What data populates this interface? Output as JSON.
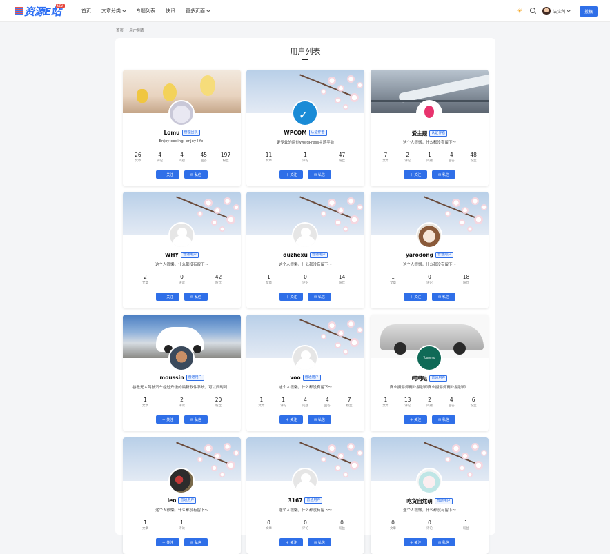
{
  "header": {
    "logo_text": "资源E站",
    "logo_badge": "NEW",
    "nav": [
      "首页",
      "文章分类",
      "专题列表",
      "快讯",
      "更多页面"
    ],
    "nav_dropdown": [
      false,
      true,
      false,
      false,
      true
    ],
    "user_name": "法拉利",
    "post_button": "投稿"
  },
  "breadcrumb": {
    "home": "首页",
    "current": "用户列表"
  },
  "page": {
    "title": "用户列表"
  },
  "actions": {
    "follow": "＋ 关注",
    "message": "✉ 私信"
  },
  "users": [
    {
      "name": "Lomu",
      "badge": "管理团队",
      "bio": "Enjoy coding, enjoy life!",
      "cover": "chicks",
      "avatar": "cat",
      "stats": [
        {
          "v": "26",
          "l": "文章"
        },
        {
          "v": "4",
          "l": "评论"
        },
        {
          "v": "4",
          "l": "问题"
        },
        {
          "v": "45",
          "l": "回答"
        },
        {
          "v": "197",
          "l": "粉丝"
        }
      ]
    },
    {
      "name": "WPCOM",
      "badge": "认证作者",
      "bio": "更专业的原创WordPress主题平台",
      "cover": "blossom",
      "avatar": "wpcom",
      "stats": [
        {
          "v": "11",
          "l": "文章"
        },
        {
          "v": "1",
          "l": "评论"
        },
        {
          "v": "47",
          "l": "粉丝"
        }
      ]
    },
    {
      "name": "爱主题",
      "badge": "认证作者",
      "bio": "这个人很懒，什么都没有留下～",
      "cover": "train",
      "avatar": "heart",
      "stats": [
        {
          "v": "7",
          "l": "文章"
        },
        {
          "v": "2",
          "l": "评论"
        },
        {
          "v": "1",
          "l": "问题"
        },
        {
          "v": "4",
          "l": "回答"
        },
        {
          "v": "48",
          "l": "粉丝"
        }
      ]
    },
    {
      "name": "WHY",
      "badge": "普通用户",
      "bio": "这个人很懒，什么都没有留下～",
      "cover": "blossom",
      "avatar": "default",
      "stats": [
        {
          "v": "2",
          "l": "文章"
        },
        {
          "v": "0",
          "l": "评论"
        },
        {
          "v": "42",
          "l": "粉丝"
        }
      ]
    },
    {
      "name": "duzhexu",
      "badge": "普通用户",
      "bio": "这个人很懒，什么都没有留下～",
      "cover": "blossom",
      "avatar": "default",
      "stats": [
        {
          "v": "1",
          "l": "文章"
        },
        {
          "v": "0",
          "l": "评论"
        },
        {
          "v": "14",
          "l": "粉丝"
        }
      ]
    },
    {
      "name": "yarodong",
      "badge": "普通用户",
      "bio": "这个人很懒，什么都没有留下～",
      "cover": "blossom",
      "avatar": "anime",
      "stats": [
        {
          "v": "1",
          "l": "文章"
        },
        {
          "v": "0",
          "l": "评论"
        },
        {
          "v": "18",
          "l": "粉丝"
        }
      ]
    },
    {
      "name": "moussin",
      "badge": "普通用户",
      "bio": "谷歌无人驾驶汽车经过升级的最新软件系统，可以同时对...",
      "cover": "car1",
      "avatar": "man",
      "stats": [
        {
          "v": "1",
          "l": "文章"
        },
        {
          "v": "2",
          "l": "评论"
        },
        {
          "v": "20",
          "l": "粉丝"
        }
      ]
    },
    {
      "name": "voo",
      "badge": "普通用户",
      "bio": "这个人很懒，什么都没有留下～",
      "cover": "blossom",
      "avatar": "default",
      "stats": [
        {
          "v": "1",
          "l": "文章"
        },
        {
          "v": "1",
          "l": "评论"
        },
        {
          "v": "4",
          "l": "问题"
        },
        {
          "v": "4",
          "l": "回答"
        },
        {
          "v": "7",
          "l": "粉丝"
        }
      ]
    },
    {
      "name": "呵呵哒",
      "badge": "普通用户",
      "bio": "商业摄影师商业摄影师商业摄影师商业摄影师...",
      "cover": "car2",
      "avatar": "toommo",
      "stats": [
        {
          "v": "1",
          "l": "文章"
        },
        {
          "v": "13",
          "l": "评论"
        },
        {
          "v": "2",
          "l": "问题"
        },
        {
          "v": "4",
          "l": "回答"
        },
        {
          "v": "6",
          "l": "粉丝"
        }
      ]
    },
    {
      "name": "leo",
      "badge": "普通用户",
      "bio": "这个人很懒，什么都没有留下～",
      "cover": "blossom",
      "avatar": "photo",
      "stats": [
        {
          "v": "1",
          "l": "文章"
        },
        {
          "v": "1",
          "l": "评论"
        },
        {
          "v": "",
          "l": ""
        }
      ]
    },
    {
      "name": "3167",
      "badge": "普通用户",
      "bio": "这个人很懒，什么都没有留下～",
      "cover": "blossom",
      "avatar": "default",
      "stats": [
        {
          "v": "0",
          "l": "文章"
        },
        {
          "v": "0",
          "l": "评论"
        },
        {
          "v": "0",
          "l": "粉丝"
        }
      ]
    },
    {
      "name": "吃货自然萌",
      "badge": "普通用户",
      "bio": "这个人很懒，什么都没有留下～",
      "cover": "blossom",
      "avatar": "anime2",
      "stats": [
        {
          "v": "0",
          "l": "文章"
        },
        {
          "v": "0",
          "l": "评论"
        },
        {
          "v": "1",
          "l": "粉丝"
        }
      ]
    }
  ],
  "avatar_labels": {
    "toommo": "Toommo"
  }
}
